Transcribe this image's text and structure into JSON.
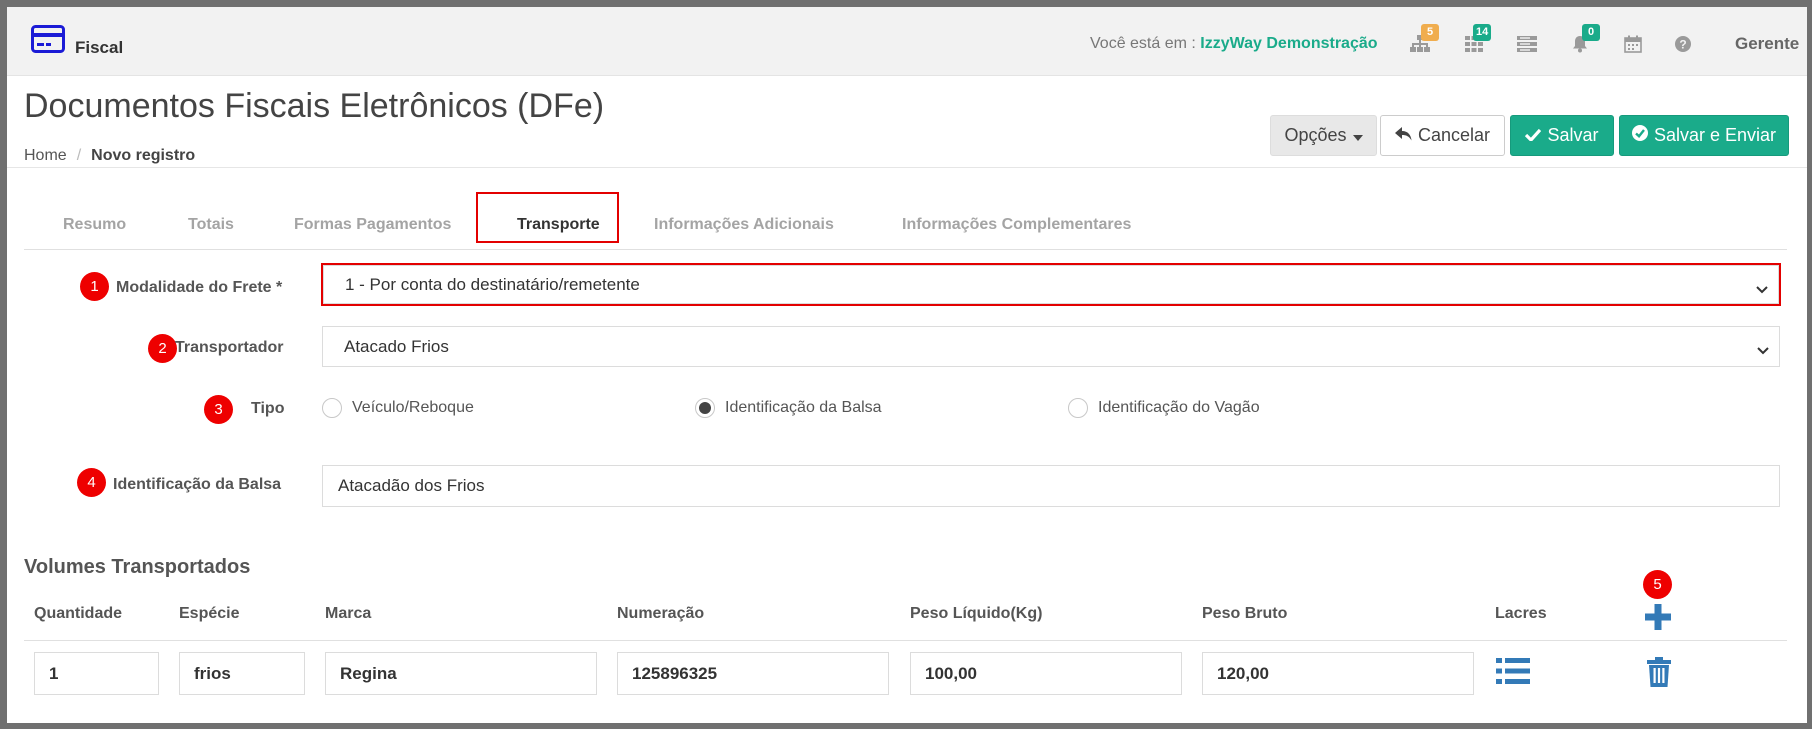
{
  "topbar": {
    "module": "Fiscal",
    "module_icon": "card-icon",
    "location_prefix": "Você está em : ",
    "company": "IzzyWay Demonstração",
    "icons": [
      {
        "name": "sitemap-icon",
        "badge": "5",
        "badge_color": "#f0ad4e"
      },
      {
        "name": "grid-icon",
        "badge": "14",
        "badge_color": "#1aab8a"
      },
      {
        "name": "list-icon",
        "badge": null
      },
      {
        "name": "bell-icon",
        "badge": "0",
        "badge_color": "#1aab8a"
      },
      {
        "name": "calendar-icon",
        "badge": null
      },
      {
        "name": "help-icon",
        "badge": null
      }
    ],
    "user": "Gerente"
  },
  "header": {
    "title": "Documentos Fiscais Eletrônicos (DFe)",
    "breadcrumb": [
      "Home",
      "Novo registro"
    ],
    "buttons": {
      "options": "Opções",
      "cancel": "Cancelar",
      "save": "Salvar",
      "save_send": "Salvar e Enviar"
    }
  },
  "tabs": [
    {
      "label": "Resumo",
      "active": false
    },
    {
      "label": "Totais",
      "active": false
    },
    {
      "label": "Formas Pagamentos",
      "active": false
    },
    {
      "label": "Transporte",
      "active": true
    },
    {
      "label": "Informações Adicionais",
      "active": false
    },
    {
      "label": "Informações Complementares",
      "active": false
    }
  ],
  "form": {
    "modalidade": {
      "marker": "1",
      "label": "Modalidade do Frete",
      "required": " *",
      "value": "1 - Por conta do destinatário/remetente"
    },
    "transportador": {
      "marker": "2",
      "label": "Transportador",
      "value": "Atacado Frios"
    },
    "tipo": {
      "marker": "3",
      "label": "Tipo",
      "options": [
        {
          "label": "Veículo/Reboque",
          "selected": false
        },
        {
          "label": "Identificação da Balsa",
          "selected": true
        },
        {
          "label": "Identificação do Vagão",
          "selected": false
        }
      ]
    },
    "balsa": {
      "marker": "4",
      "label": "Identificação da Balsa",
      "value": "Atacadão dos Frios"
    }
  },
  "volumes": {
    "title": "Volumes Transportados",
    "add_marker": "5",
    "columns": [
      "Quantidade",
      "Espécie",
      "Marca",
      "Numeração",
      "Peso Líquido(Kg)",
      "Peso Bruto",
      "Lacres"
    ],
    "rows": [
      {
        "quantidade": "1",
        "especie": "frios",
        "marca": "Regina",
        "numeracao": "125896325",
        "peso_liquido": "100,00",
        "peso_bruto": "120,00"
      }
    ]
  },
  "colors": {
    "accent": "#1aab8a",
    "highlight": "#e30000",
    "marker": "#ee0000",
    "icon_blue": "#337ab7"
  }
}
